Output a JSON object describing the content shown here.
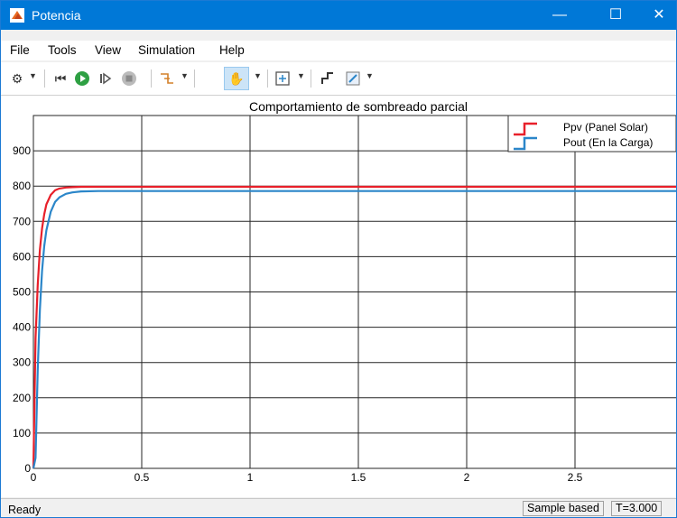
{
  "window": {
    "title": "Potencia",
    "minimize_glyph": "—",
    "maximize_glyph": "☐",
    "close_glyph": "✕"
  },
  "menu": {
    "items": [
      "File",
      "Tools",
      "View",
      "Simulation",
      "Help"
    ]
  },
  "toolbar": {
    "icons": [
      "gear-icon",
      "rewind-icon",
      "run-icon",
      "step-forward-icon",
      "stop-icon",
      "signal-select-icon",
      "pan-icon",
      "zoom-fit-icon",
      "cursor-measure-icon",
      "edit-style-icon"
    ]
  },
  "chart_data": {
    "type": "line",
    "title": "Comportamiento de sombreado parcial",
    "xlabel": "",
    "ylabel": "",
    "xlim": [
      0,
      3
    ],
    "ylim": [
      0,
      1000
    ],
    "xticks": [
      0,
      0.5,
      1,
      1.5,
      2,
      2.5
    ],
    "xtick_labels": [
      "0",
      "0.5",
      "1",
      "1.5",
      "2",
      "2.5"
    ],
    "yticks": [
      0,
      100,
      200,
      300,
      400,
      500,
      600,
      700,
      800,
      900
    ],
    "ytick_labels": [
      "0",
      "100",
      "200",
      "300",
      "400",
      "500",
      "600",
      "700",
      "800",
      "900"
    ],
    "grid": true,
    "legend_position": "top-right",
    "series": [
      {
        "name": "Ppv (Panel Solar)",
        "color": "#e8202a",
        "x": [
          0,
          0.01,
          0.02,
          0.03,
          0.04,
          0.05,
          0.06,
          0.08,
          0.1,
          0.12,
          0.15,
          0.18,
          0.22,
          0.3,
          0.5,
          1,
          1.5,
          2,
          2.5,
          3
        ],
        "y": [
          0,
          370,
          520,
          620,
          680,
          720,
          748,
          775,
          788,
          793,
          796,
          797,
          798,
          798,
          798,
          798,
          798,
          798,
          798,
          798
        ]
      },
      {
        "name": "Pout (En la Carga)",
        "color": "#2b86c9",
        "x": [
          0,
          0.01,
          0.02,
          0.03,
          0.04,
          0.05,
          0.06,
          0.08,
          0.1,
          0.12,
          0.15,
          0.18,
          0.22,
          0.3,
          0.5,
          1,
          1.5,
          2,
          2.5,
          3
        ],
        "y": [
          0,
          30,
          280,
          450,
          560,
          630,
          675,
          727,
          755,
          768,
          778,
          782,
          785,
          786,
          786,
          786,
          786,
          786,
          786,
          786
        ]
      }
    ]
  },
  "status": {
    "left": "Ready",
    "mode": "Sample based",
    "time": "T=3.000"
  }
}
